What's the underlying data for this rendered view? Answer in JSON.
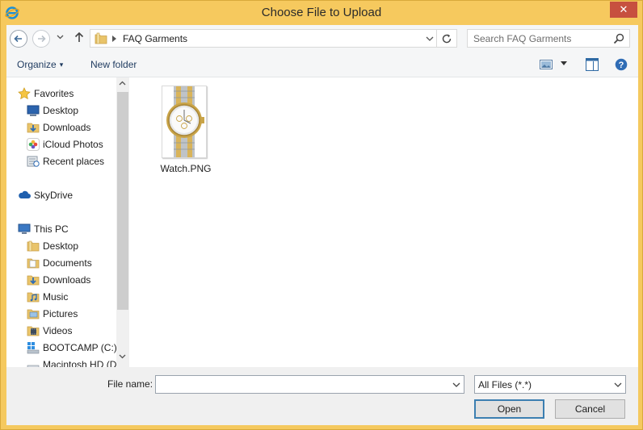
{
  "window": {
    "title": "Choose File to Upload",
    "app_icon": "ie-icon",
    "close_glyph": "✕"
  },
  "address_bar": {
    "breadcrumb": [
      "FAQ Garments"
    ],
    "search_placeholder": "Search FAQ Garments"
  },
  "command_bar": {
    "organize_label": "Organize",
    "organize_caret": "▾",
    "new_folder_label": "New folder"
  },
  "nav_pane": {
    "favorites": {
      "label": "Favorites",
      "items": [
        {
          "label": "Desktop",
          "icon": "desktop-icon"
        },
        {
          "label": "Downloads",
          "icon": "downloads-icon"
        },
        {
          "label": "iCloud Photos",
          "icon": "icloud-photos-icon"
        },
        {
          "label": "Recent places",
          "icon": "recent-places-icon"
        }
      ]
    },
    "skydrive": {
      "label": "SkyDrive",
      "icon": "cloud-icon"
    },
    "this_pc": {
      "label": "This PC",
      "items": [
        {
          "label": "Desktop",
          "icon": "folder-icon"
        },
        {
          "label": "Documents",
          "icon": "folder-icon"
        },
        {
          "label": "Downloads",
          "icon": "folder-icon"
        },
        {
          "label": "Music",
          "icon": "music-folder-icon"
        },
        {
          "label": "Pictures",
          "icon": "pictures-folder-icon"
        },
        {
          "label": "Videos",
          "icon": "videos-folder-icon"
        },
        {
          "label": "BOOTCAMP (C:)",
          "icon": "windows-drive-icon"
        },
        {
          "label": "Macintosh HD (D",
          "icon": "drive-icon"
        }
      ]
    }
  },
  "files": [
    {
      "name": "Watch.PNG",
      "thumbnail": "watch-thumbnail"
    }
  ],
  "bottom": {
    "file_name_label": "File name:",
    "file_name_value": "",
    "file_type_value": "All Files (*.*)",
    "open_label": "Open",
    "cancel_label": "Cancel"
  },
  "colors": {
    "frame": "#f5c95f",
    "close_button": "#c7503f",
    "command_text": "#1e3a5f",
    "default_button_border": "#3c7fb1"
  }
}
